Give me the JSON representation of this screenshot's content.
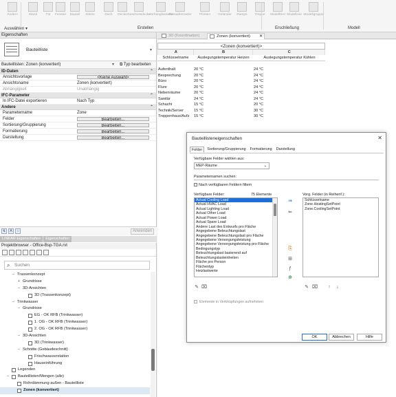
{
  "ribbon": {
    "buttons": [
      "Ändern",
      "Wand",
      "Tür",
      "Fenster",
      "Bauteil",
      "Stütze",
      "Dach",
      "Decke",
      "Geschossdecke",
      "Vorhangfassade",
      "Fassadenraster",
      "Pfosten",
      "Geländer",
      "Rampe",
      "Treppe",
      "Modelltext",
      "Modellinie",
      "Modellgruppe"
    ],
    "groups": [
      "Auswählen ▾",
      "Erstellen",
      "Erschließung",
      "Modell"
    ]
  },
  "properties": {
    "panel_title": "Eigenschaften",
    "type_name": "Bauteilliste",
    "instance_filter": "Bauteillisten: Zonen (konvertiert)",
    "edit_type": "Typ bearbeiten",
    "apply_label": "Anwenden",
    "sections": [
      {
        "title": "ID-Daten",
        "rows": [
          {
            "label": "Ansichtsvorlage",
            "value": "<Keine Auswahl>",
            "button": true,
            "dim": false
          },
          {
            "label": "Ansichtsname",
            "value": "Zonen (konvertiert)",
            "button": false,
            "dim": false
          },
          {
            "label": "Abhängigkeit",
            "value": "Unabhängig",
            "button": false,
            "dim": true
          }
        ]
      },
      {
        "title": "IFC-Parameter",
        "rows": [
          {
            "label": "In IFC-Datei exportieren",
            "value": "Nach Typ",
            "button": false,
            "dim": false
          }
        ]
      },
      {
        "title": "Andere",
        "rows": [
          {
            "label": "Parametername",
            "value": "Zone",
            "button": false,
            "dim": false
          },
          {
            "label": "Felder",
            "value": "Bearbeiten...",
            "button": true,
            "dim": false
          },
          {
            "label": "Sortierung/Gruppierung",
            "value": "Bearbeiten...",
            "button": true,
            "dim": false
          },
          {
            "label": "Formatierung",
            "value": "Bearbeiten...",
            "button": true,
            "dim": false
          },
          {
            "label": "Darstellung",
            "value": "Bearbeiten...",
            "button": true,
            "dim": false
          }
        ]
      }
    ]
  },
  "panel_tabs": [
    "LINEAR Eigenschaften",
    "Eigenschaften"
  ],
  "browser": {
    "title": "Projektbrowser - Office-Bsp-TGA.rvt",
    "search_placeholder": "Suchen",
    "tree": [
      {
        "label": "Trassenkonzept",
        "level": 1,
        "toggle": "−",
        "icon": false,
        "selected": false
      },
      {
        "label": "Grundrisse",
        "level": 2,
        "toggle": "+",
        "icon": false,
        "selected": false
      },
      {
        "label": "3D-Ansichten",
        "level": 2,
        "toggle": "−",
        "icon": false,
        "selected": false
      },
      {
        "label": "3D (Trassenkonzept)",
        "level": 3,
        "toggle": "",
        "icon": true,
        "selected": false
      },
      {
        "label": "Trinkwasser",
        "level": 1,
        "toggle": "−",
        "icon": false,
        "selected": false
      },
      {
        "label": "Grundrisse",
        "level": 2,
        "toggle": "−",
        "icon": false,
        "selected": false
      },
      {
        "label": "EG - OK RFB (Trinkwasser)",
        "level": 3,
        "toggle": "",
        "icon": true,
        "selected": false
      },
      {
        "label": "1. OG - OK RFB (Trinkwasser)",
        "level": 3,
        "toggle": "",
        "icon": true,
        "selected": false
      },
      {
        "label": "2. OG - OK RFB (Trinkwasser)",
        "level": 3,
        "toggle": "",
        "icon": true,
        "selected": false
      },
      {
        "label": "3D-Ansichten",
        "level": 2,
        "toggle": "−",
        "icon": false,
        "selected": false
      },
      {
        "label": "3D (Trinkwasser)",
        "level": 3,
        "toggle": "",
        "icon": true,
        "selected": false
      },
      {
        "label": "Schnitte (Gebäudeschnitt)",
        "level": 2,
        "toggle": "−",
        "icon": false,
        "selected": false
      },
      {
        "label": "Frischwasserstation",
        "level": 3,
        "toggle": "",
        "icon": true,
        "selected": false
      },
      {
        "label": "Hauseinführung",
        "level": 3,
        "toggle": "",
        "icon": true,
        "selected": false
      },
      {
        "label": "Legenden",
        "level": 0,
        "toggle": "",
        "icon": true,
        "selected": false
      },
      {
        "label": "Bauteillisten/Mengen (alle)",
        "level": 0,
        "toggle": "−",
        "icon": true,
        "selected": false
      },
      {
        "label": "Rohrdämmung außen - Bauteilliste",
        "level": 1,
        "toggle": "",
        "icon": true,
        "selected": false
      },
      {
        "label": "Zonen (konvertiert)",
        "level": 1,
        "toggle": "",
        "icon": true,
        "selected": true
      }
    ]
  },
  "view_tabs": {
    "tab1": "3D (Koordination)",
    "tab2": "Zonen (konvertiert)",
    "close": "✕"
  },
  "schedule": {
    "title": "<Zonen (konvertiert)>",
    "letters": [
      "A",
      "B",
      "C"
    ],
    "headers": [
      "Schlüsselname",
      "Auslegungstemperatur Heizen",
      "Auslegungstemperatur Kühlen"
    ],
    "rows": [
      [
        "Aufenthalt",
        "20 °C",
        "24 °C"
      ],
      [
        "Besprechung",
        "20 °C",
        "24 °C"
      ],
      [
        "Büro",
        "20 °C",
        "24 °C"
      ],
      [
        "Flure",
        "20 °C",
        "24 °C"
      ],
      [
        "Nebenräume",
        "20 °C",
        "24 °C"
      ],
      [
        "Sanitär",
        "24 °C",
        "24 °C"
      ],
      [
        "Schacht",
        "15 °C",
        "20 °C"
      ],
      [
        "Technik/Server",
        "15 °C",
        "30 °C"
      ],
      [
        "Treppenhaus/Aufz",
        "15 °C",
        "30 °C"
      ]
    ]
  },
  "dialog": {
    "title": "Bauteillisteneigenschaften",
    "close": "✕",
    "tabs": [
      "Felder",
      "Sortierung/Gruppierung",
      "Formatierung",
      "Darstellung"
    ],
    "fields_from_label": "Verfügbare Felder wählen aus:",
    "category": "MEP-Räume",
    "param_search_label": "Parameternamen suchen:",
    "filter_label": "Nach verfügbaren Feldern filtern",
    "available_label": "Verfügbare Felder:",
    "available_count": "75 Elemente",
    "available_fields": [
      "Actual Cooling Load",
      "Actual HVAC Load",
      "Actual Lighting Load",
      "Actual Other Load",
      "Actual Power Load",
      "Actual Spare Load",
      "Andere Last des Entwurfs pro Fläche",
      "Angegebene Beleuchtungslast",
      "Angegebene Beleuchtungslast pro Fläche",
      "Angegebene Versorgungsleistung",
      "Angegebene Versorgungsleistung pro Fläche",
      "Bedingungstyp",
      "Beleuchtungslast basierend auf",
      "Beleuchtungslasteinheiten",
      "Fläche pro Person",
      "Flächentyp",
      "Heizlastwerte"
    ],
    "schedule_label": "Vorg. Felder (in Reihenf.):",
    "schedule_fields": [
      "Schlüsselname",
      "Zone.HeatingSetPoint",
      "Zone.CoolingSetPoint"
    ],
    "link_label": "Elemente in Verknüpfungen aufnehmen",
    "ok": "OK",
    "cancel": "Abbrechen",
    "help": "Hilfe"
  }
}
